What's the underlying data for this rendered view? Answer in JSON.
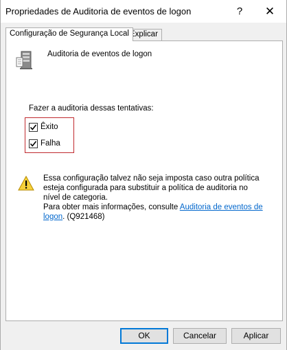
{
  "window": {
    "title": "Propriedades de Auditoria de eventos de logon",
    "help_glyph": "?",
    "close_glyph": "✕"
  },
  "tabs": [
    {
      "label": "Configuração de Segurança Local",
      "active": true
    },
    {
      "label": "Explicar",
      "active": false
    }
  ],
  "policy": {
    "icon": "server-policy-icon",
    "name": "Auditoria de eventos de logon"
  },
  "audit": {
    "label": "Fazer a auditoria dessas tentativas:",
    "options": [
      {
        "label": "Êxito",
        "checked": true
      },
      {
        "label": "Falha",
        "checked": true
      }
    ],
    "highlight_color": "#c0282d"
  },
  "warning": {
    "icon": "warning-icon",
    "text1": "Essa configuração talvez não seja imposta caso outra política esteja configurada para substituir a política de auditoria no nível de categoria.",
    "text2_prefix": "Para obter mais informações, consulte ",
    "link_text": "Auditoria de eventos de logon",
    "text2_suffix": ". (Q921468)"
  },
  "buttons": {
    "ok": "OK",
    "cancel": "Cancelar",
    "apply": "Aplicar"
  },
  "colors": {
    "accent": "#0078d7",
    "link": "#0066cc"
  }
}
